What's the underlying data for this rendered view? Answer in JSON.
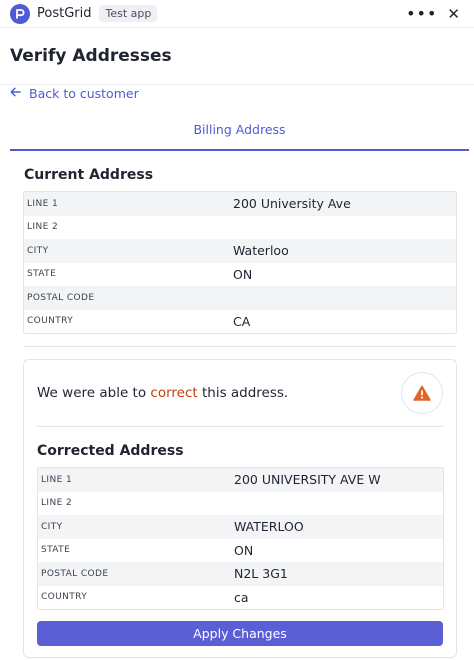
{
  "app": {
    "name": "PostGrid",
    "environment_badge": "Test app",
    "more_label": "•••",
    "close_label": "✕"
  },
  "page": {
    "title": "Verify Addresses",
    "back_label": "Back to customer",
    "tab_label": "Billing Address"
  },
  "current_address": {
    "title": "Current Address",
    "rows": [
      {
        "label": "LINE 1",
        "value": "200 University Ave"
      },
      {
        "label": "LINE 2",
        "value": ""
      },
      {
        "label": "CITY",
        "value": "Waterloo"
      },
      {
        "label": "STATE",
        "value": "ON"
      },
      {
        "label": "POSTAL CODE",
        "value": ""
      },
      {
        "label": "COUNTRY",
        "value": "CA"
      }
    ]
  },
  "correction": {
    "message_prefix": "We were able to ",
    "message_accent": "correct",
    "message_suffix": " this address.",
    "icon": "warning-icon",
    "title": "Corrected Address",
    "rows": [
      {
        "label": "LINE 1",
        "value": "200 UNIVERSITY AVE W"
      },
      {
        "label": "LINE 2",
        "value": ""
      },
      {
        "label": "CITY",
        "value": "WATERLOO"
      },
      {
        "label": "STATE",
        "value": "ON"
      },
      {
        "label": "POSTAL CODE",
        "value": "N2L 3G1"
      },
      {
        "label": "COUNTRY",
        "value": "ca"
      }
    ],
    "apply_label": "Apply Changes"
  },
  "colors": {
    "accent": "#4f5bd5",
    "button": "#5b5fd6",
    "warning": "#e0652b",
    "highlight_text": "#c2410c"
  }
}
